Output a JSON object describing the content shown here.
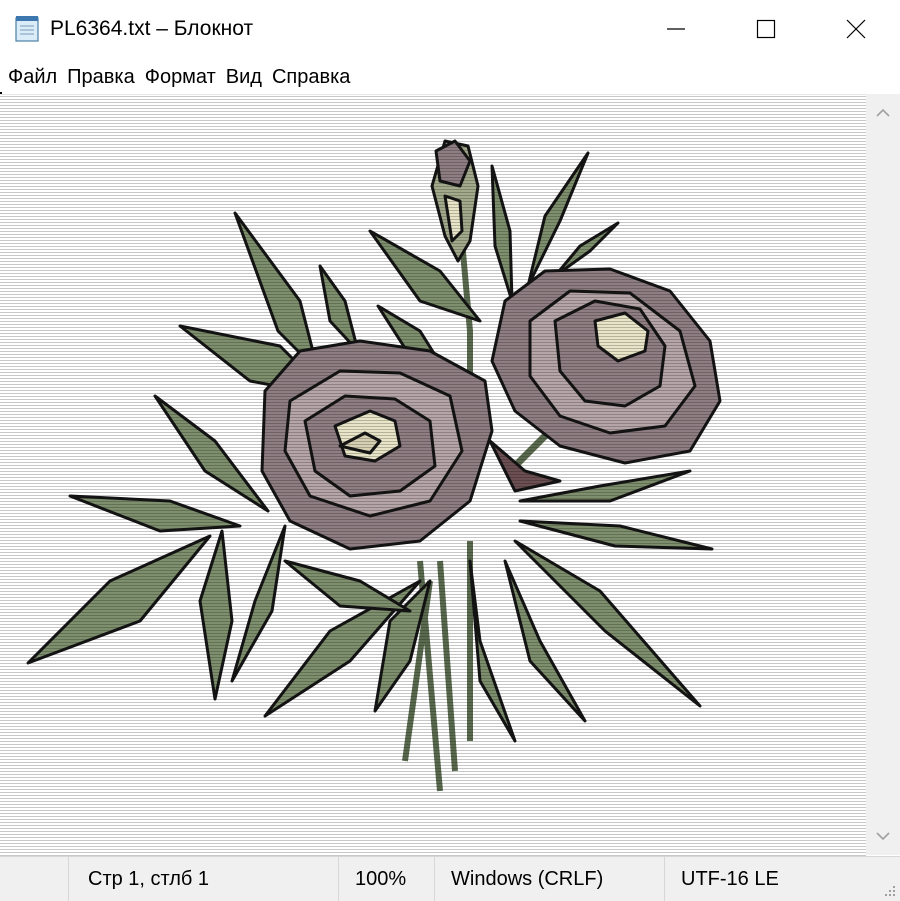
{
  "window": {
    "title": "PL6364.txt – Блокнот",
    "icon": "notepad-icon",
    "controls": [
      "minimize-icon",
      "maximize-icon",
      "close-icon"
    ]
  },
  "menu": [
    "Файл",
    "Правка",
    "Формат",
    "Вид",
    "Справка"
  ],
  "status": {
    "position": "Стр 1, стлб 1",
    "zoom": "100%",
    "line_endings": "Windows (CRLF)",
    "encoding": "UTF-16 LE"
  },
  "colors": {
    "leaf": "#7e8f6e",
    "leaf_dark": "#5a6a4e",
    "petal": "#8e7d82",
    "petal_light": "#b5a5a8",
    "center": "#e8e4c8",
    "outline": "#141414"
  }
}
